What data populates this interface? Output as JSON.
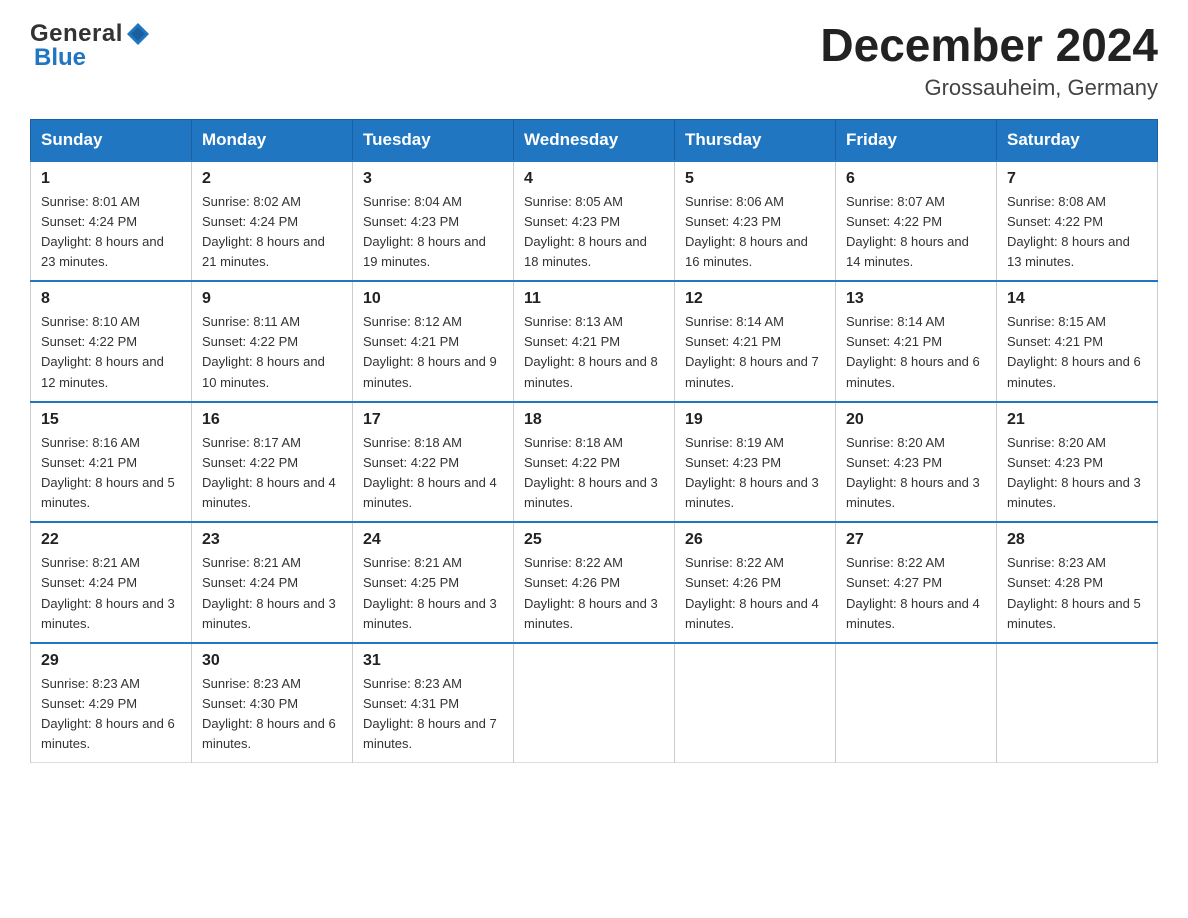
{
  "header": {
    "logo_general": "General",
    "logo_blue": "Blue",
    "title": "December 2024",
    "subtitle": "Grossauheim, Germany"
  },
  "weekdays": [
    "Sunday",
    "Monday",
    "Tuesday",
    "Wednesday",
    "Thursday",
    "Friday",
    "Saturday"
  ],
  "weeks": [
    [
      {
        "day": "1",
        "sunrise": "8:01 AM",
        "sunset": "4:24 PM",
        "daylight": "8 hours and 23 minutes."
      },
      {
        "day": "2",
        "sunrise": "8:02 AM",
        "sunset": "4:24 PM",
        "daylight": "8 hours and 21 minutes."
      },
      {
        "day": "3",
        "sunrise": "8:04 AM",
        "sunset": "4:23 PM",
        "daylight": "8 hours and 19 minutes."
      },
      {
        "day": "4",
        "sunrise": "8:05 AM",
        "sunset": "4:23 PM",
        "daylight": "8 hours and 18 minutes."
      },
      {
        "day": "5",
        "sunrise": "8:06 AM",
        "sunset": "4:23 PM",
        "daylight": "8 hours and 16 minutes."
      },
      {
        "day": "6",
        "sunrise": "8:07 AM",
        "sunset": "4:22 PM",
        "daylight": "8 hours and 14 minutes."
      },
      {
        "day": "7",
        "sunrise": "8:08 AM",
        "sunset": "4:22 PM",
        "daylight": "8 hours and 13 minutes."
      }
    ],
    [
      {
        "day": "8",
        "sunrise": "8:10 AM",
        "sunset": "4:22 PM",
        "daylight": "8 hours and 12 minutes."
      },
      {
        "day": "9",
        "sunrise": "8:11 AM",
        "sunset": "4:22 PM",
        "daylight": "8 hours and 10 minutes."
      },
      {
        "day": "10",
        "sunrise": "8:12 AM",
        "sunset": "4:21 PM",
        "daylight": "8 hours and 9 minutes."
      },
      {
        "day": "11",
        "sunrise": "8:13 AM",
        "sunset": "4:21 PM",
        "daylight": "8 hours and 8 minutes."
      },
      {
        "day": "12",
        "sunrise": "8:14 AM",
        "sunset": "4:21 PM",
        "daylight": "8 hours and 7 minutes."
      },
      {
        "day": "13",
        "sunrise": "8:14 AM",
        "sunset": "4:21 PM",
        "daylight": "8 hours and 6 minutes."
      },
      {
        "day": "14",
        "sunrise": "8:15 AM",
        "sunset": "4:21 PM",
        "daylight": "8 hours and 6 minutes."
      }
    ],
    [
      {
        "day": "15",
        "sunrise": "8:16 AM",
        "sunset": "4:21 PM",
        "daylight": "8 hours and 5 minutes."
      },
      {
        "day": "16",
        "sunrise": "8:17 AM",
        "sunset": "4:22 PM",
        "daylight": "8 hours and 4 minutes."
      },
      {
        "day": "17",
        "sunrise": "8:18 AM",
        "sunset": "4:22 PM",
        "daylight": "8 hours and 4 minutes."
      },
      {
        "day": "18",
        "sunrise": "8:18 AM",
        "sunset": "4:22 PM",
        "daylight": "8 hours and 3 minutes."
      },
      {
        "day": "19",
        "sunrise": "8:19 AM",
        "sunset": "4:23 PM",
        "daylight": "8 hours and 3 minutes."
      },
      {
        "day": "20",
        "sunrise": "8:20 AM",
        "sunset": "4:23 PM",
        "daylight": "8 hours and 3 minutes."
      },
      {
        "day": "21",
        "sunrise": "8:20 AM",
        "sunset": "4:23 PM",
        "daylight": "8 hours and 3 minutes."
      }
    ],
    [
      {
        "day": "22",
        "sunrise": "8:21 AM",
        "sunset": "4:24 PM",
        "daylight": "8 hours and 3 minutes."
      },
      {
        "day": "23",
        "sunrise": "8:21 AM",
        "sunset": "4:24 PM",
        "daylight": "8 hours and 3 minutes."
      },
      {
        "day": "24",
        "sunrise": "8:21 AM",
        "sunset": "4:25 PM",
        "daylight": "8 hours and 3 minutes."
      },
      {
        "day": "25",
        "sunrise": "8:22 AM",
        "sunset": "4:26 PM",
        "daylight": "8 hours and 3 minutes."
      },
      {
        "day": "26",
        "sunrise": "8:22 AM",
        "sunset": "4:26 PM",
        "daylight": "8 hours and 4 minutes."
      },
      {
        "day": "27",
        "sunrise": "8:22 AM",
        "sunset": "4:27 PM",
        "daylight": "8 hours and 4 minutes."
      },
      {
        "day": "28",
        "sunrise": "8:23 AM",
        "sunset": "4:28 PM",
        "daylight": "8 hours and 5 minutes."
      }
    ],
    [
      {
        "day": "29",
        "sunrise": "8:23 AM",
        "sunset": "4:29 PM",
        "daylight": "8 hours and 6 minutes."
      },
      {
        "day": "30",
        "sunrise": "8:23 AM",
        "sunset": "4:30 PM",
        "daylight": "8 hours and 6 minutes."
      },
      {
        "day": "31",
        "sunrise": "8:23 AM",
        "sunset": "4:31 PM",
        "daylight": "8 hours and 7 minutes."
      },
      null,
      null,
      null,
      null
    ]
  ]
}
